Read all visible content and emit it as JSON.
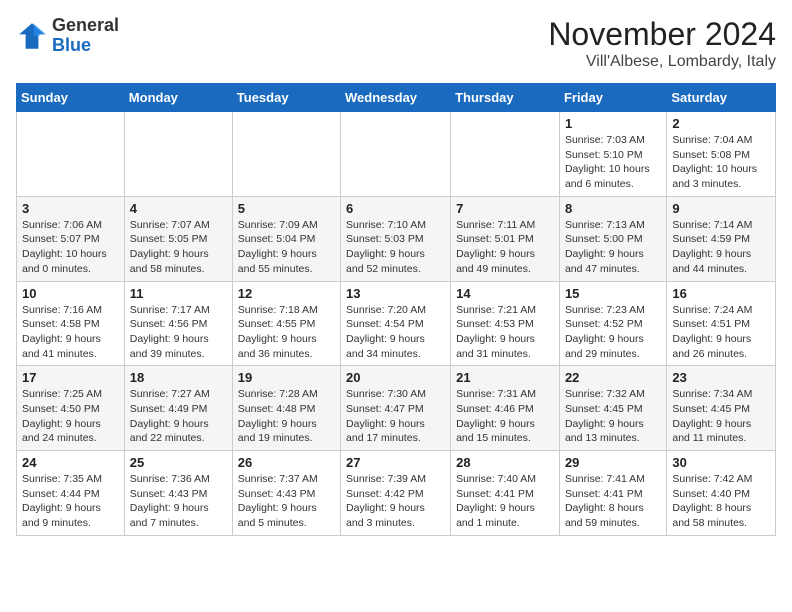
{
  "header": {
    "logo_general": "General",
    "logo_blue": "Blue",
    "month_title": "November 2024",
    "location": "Vill'Albese, Lombardy, Italy"
  },
  "weekdays": [
    "Sunday",
    "Monday",
    "Tuesday",
    "Wednesday",
    "Thursday",
    "Friday",
    "Saturday"
  ],
  "weeks": [
    [
      {
        "day": "",
        "info": ""
      },
      {
        "day": "",
        "info": ""
      },
      {
        "day": "",
        "info": ""
      },
      {
        "day": "",
        "info": ""
      },
      {
        "day": "",
        "info": ""
      },
      {
        "day": "1",
        "info": "Sunrise: 7:03 AM\nSunset: 5:10 PM\nDaylight: 10 hours and 6 minutes."
      },
      {
        "day": "2",
        "info": "Sunrise: 7:04 AM\nSunset: 5:08 PM\nDaylight: 10 hours and 3 minutes."
      }
    ],
    [
      {
        "day": "3",
        "info": "Sunrise: 7:06 AM\nSunset: 5:07 PM\nDaylight: 10 hours and 0 minutes."
      },
      {
        "day": "4",
        "info": "Sunrise: 7:07 AM\nSunset: 5:05 PM\nDaylight: 9 hours and 58 minutes."
      },
      {
        "day": "5",
        "info": "Sunrise: 7:09 AM\nSunset: 5:04 PM\nDaylight: 9 hours and 55 minutes."
      },
      {
        "day": "6",
        "info": "Sunrise: 7:10 AM\nSunset: 5:03 PM\nDaylight: 9 hours and 52 minutes."
      },
      {
        "day": "7",
        "info": "Sunrise: 7:11 AM\nSunset: 5:01 PM\nDaylight: 9 hours and 49 minutes."
      },
      {
        "day": "8",
        "info": "Sunrise: 7:13 AM\nSunset: 5:00 PM\nDaylight: 9 hours and 47 minutes."
      },
      {
        "day": "9",
        "info": "Sunrise: 7:14 AM\nSunset: 4:59 PM\nDaylight: 9 hours and 44 minutes."
      }
    ],
    [
      {
        "day": "10",
        "info": "Sunrise: 7:16 AM\nSunset: 4:58 PM\nDaylight: 9 hours and 41 minutes."
      },
      {
        "day": "11",
        "info": "Sunrise: 7:17 AM\nSunset: 4:56 PM\nDaylight: 9 hours and 39 minutes."
      },
      {
        "day": "12",
        "info": "Sunrise: 7:18 AM\nSunset: 4:55 PM\nDaylight: 9 hours and 36 minutes."
      },
      {
        "day": "13",
        "info": "Sunrise: 7:20 AM\nSunset: 4:54 PM\nDaylight: 9 hours and 34 minutes."
      },
      {
        "day": "14",
        "info": "Sunrise: 7:21 AM\nSunset: 4:53 PM\nDaylight: 9 hours and 31 minutes."
      },
      {
        "day": "15",
        "info": "Sunrise: 7:23 AM\nSunset: 4:52 PM\nDaylight: 9 hours and 29 minutes."
      },
      {
        "day": "16",
        "info": "Sunrise: 7:24 AM\nSunset: 4:51 PM\nDaylight: 9 hours and 26 minutes."
      }
    ],
    [
      {
        "day": "17",
        "info": "Sunrise: 7:25 AM\nSunset: 4:50 PM\nDaylight: 9 hours and 24 minutes."
      },
      {
        "day": "18",
        "info": "Sunrise: 7:27 AM\nSunset: 4:49 PM\nDaylight: 9 hours and 22 minutes."
      },
      {
        "day": "19",
        "info": "Sunrise: 7:28 AM\nSunset: 4:48 PM\nDaylight: 9 hours and 19 minutes."
      },
      {
        "day": "20",
        "info": "Sunrise: 7:30 AM\nSunset: 4:47 PM\nDaylight: 9 hours and 17 minutes."
      },
      {
        "day": "21",
        "info": "Sunrise: 7:31 AM\nSunset: 4:46 PM\nDaylight: 9 hours and 15 minutes."
      },
      {
        "day": "22",
        "info": "Sunrise: 7:32 AM\nSunset: 4:45 PM\nDaylight: 9 hours and 13 minutes."
      },
      {
        "day": "23",
        "info": "Sunrise: 7:34 AM\nSunset: 4:45 PM\nDaylight: 9 hours and 11 minutes."
      }
    ],
    [
      {
        "day": "24",
        "info": "Sunrise: 7:35 AM\nSunset: 4:44 PM\nDaylight: 9 hours and 9 minutes."
      },
      {
        "day": "25",
        "info": "Sunrise: 7:36 AM\nSunset: 4:43 PM\nDaylight: 9 hours and 7 minutes."
      },
      {
        "day": "26",
        "info": "Sunrise: 7:37 AM\nSunset: 4:43 PM\nDaylight: 9 hours and 5 minutes."
      },
      {
        "day": "27",
        "info": "Sunrise: 7:39 AM\nSunset: 4:42 PM\nDaylight: 9 hours and 3 minutes."
      },
      {
        "day": "28",
        "info": "Sunrise: 7:40 AM\nSunset: 4:41 PM\nDaylight: 9 hours and 1 minute."
      },
      {
        "day": "29",
        "info": "Sunrise: 7:41 AM\nSunset: 4:41 PM\nDaylight: 8 hours and 59 minutes."
      },
      {
        "day": "30",
        "info": "Sunrise: 7:42 AM\nSunset: 4:40 PM\nDaylight: 8 hours and 58 minutes."
      }
    ]
  ]
}
